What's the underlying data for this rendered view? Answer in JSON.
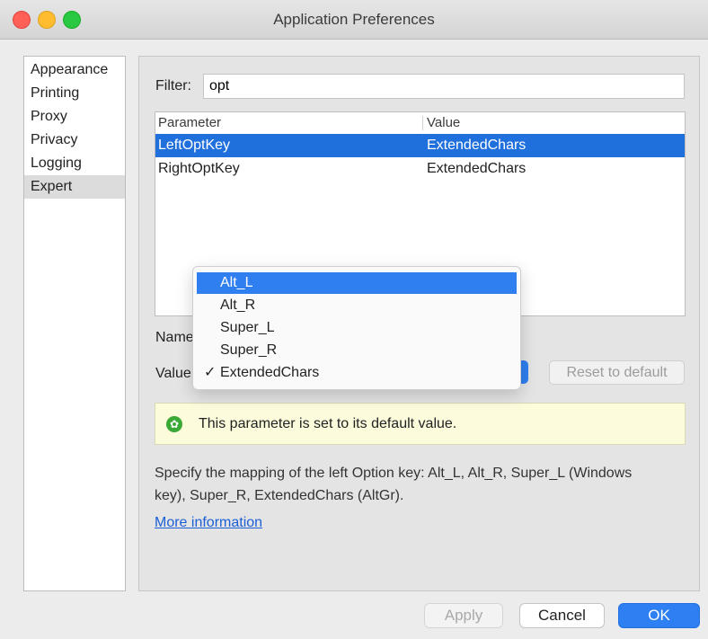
{
  "window": {
    "title": "Application Preferences"
  },
  "sidebar": {
    "items": [
      {
        "label": "Appearance"
      },
      {
        "label": "Printing"
      },
      {
        "label": "Proxy"
      },
      {
        "label": "Privacy"
      },
      {
        "label": "Logging"
      },
      {
        "label": "Expert",
        "selected": true
      }
    ]
  },
  "filter": {
    "label": "Filter:",
    "value": "opt"
  },
  "table": {
    "headers": {
      "parameter": "Parameter",
      "value": "Value"
    },
    "rows": [
      {
        "name": "LeftOptKey",
        "value": "ExtendedChars",
        "selected": true
      },
      {
        "name": "RightOptKey",
        "value": "ExtendedChars",
        "selected": false
      }
    ]
  },
  "fields": {
    "name_label": "Name",
    "value_label": "Value"
  },
  "reset_button": "Reset to default",
  "dropdown": {
    "options": [
      {
        "label": "Alt_L",
        "highlighted": true,
        "checked": false
      },
      {
        "label": "Alt_R",
        "highlighted": false,
        "checked": false
      },
      {
        "label": "Super_L",
        "highlighted": false,
        "checked": false
      },
      {
        "label": "Super_R",
        "highlighted": false,
        "checked": false
      },
      {
        "label": "ExtendedChars",
        "highlighted": false,
        "checked": true,
        "check_mark": "✓"
      }
    ]
  },
  "info": {
    "icon": "gear-icon",
    "text": "This parameter is set to its default value."
  },
  "description": {
    "line1": "Specify the mapping of the left Option key: Alt_L, Alt_R, Super_L (Windows",
    "line2": "key), Super_R, ExtendedChars (AltGr)."
  },
  "more_link": "More information",
  "buttons": {
    "apply": "Apply",
    "cancel": "Cancel",
    "ok": "OK"
  },
  "colors": {
    "accent": "#2f7ff0",
    "selection": "#1f6fdc",
    "info_bg": "#fcfcdc",
    "ok_icon": "#3aa936"
  }
}
